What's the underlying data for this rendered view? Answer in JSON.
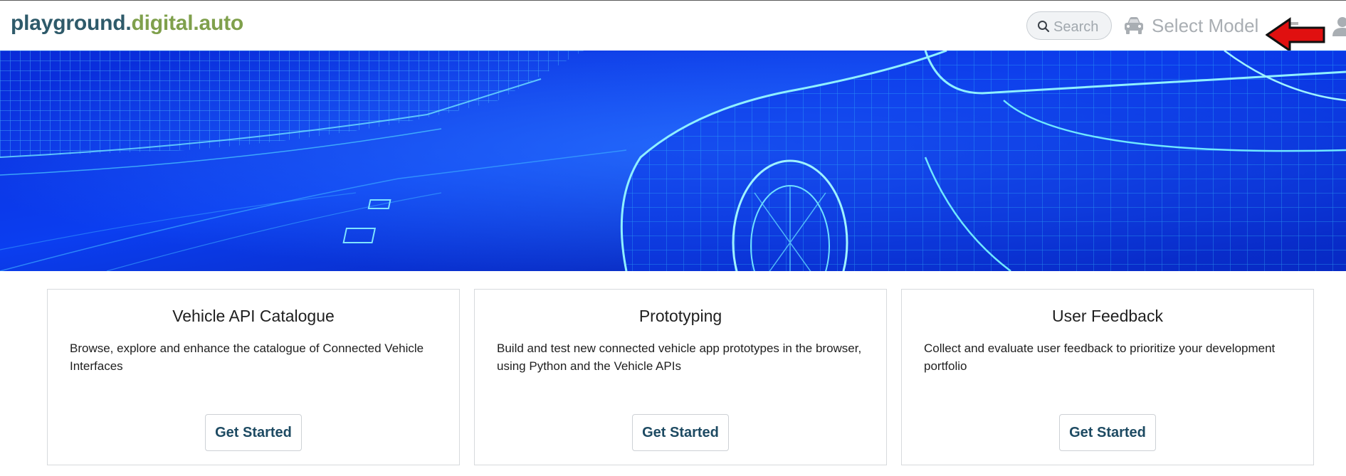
{
  "header": {
    "logo_part1": "playground.",
    "logo_part2": "digital.auto",
    "search": {
      "placeholder": "Search"
    },
    "model_selector": {
      "label": "Select Model"
    }
  },
  "icons": {
    "search": "search-icon",
    "car": "car-icon",
    "arrow": "red-arrow-left-icon",
    "user": "user-icon"
  },
  "colors": {
    "logo_primary": "#2e5a6a",
    "logo_accent": "#7fa04c",
    "button_text": "#1d4a62",
    "annotation_arrow": "#e01010"
  },
  "cards": [
    {
      "title": "Vehicle API Catalogue",
      "description": "Browse, explore and enhance the catalogue of Connected Vehicle Interfaces",
      "button": "Get Started"
    },
    {
      "title": "Prototyping",
      "description": "Build and test new connected vehicle app prototypes in the browser, using Python and the Vehicle APIs",
      "button": "Get Started"
    },
    {
      "title": "User Feedback",
      "description": "Collect and evaluate user feedback to prioritize your development portfolio",
      "button": "Get Started"
    }
  ]
}
